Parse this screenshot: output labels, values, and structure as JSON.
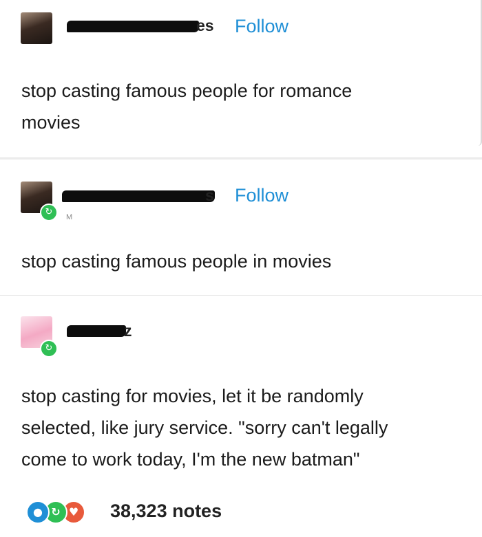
{
  "posts": [
    {
      "username_visible_suffix": "es",
      "follow_label": "Follow",
      "text_lines": [
        "stop casting famous people for romance",
        "movies"
      ]
    },
    {
      "username_visible_suffix": "s",
      "follow_label": "Follow",
      "meta": "M",
      "text_lines": [
        "stop casting famous people in movies"
      ]
    },
    {
      "username_visible_suffix": "z",
      "text_lines": [
        "stop casting for movies, let it be randomly",
        "selected, like jury service. \"sorry can't legally",
        "come to work today, I'm the new batman\""
      ]
    }
  ],
  "notes": {
    "count_label": "38,323 notes"
  },
  "icons": {
    "reblog": "reblog-icon",
    "reply": "reply-icon",
    "like": "heart-icon"
  },
  "colors": {
    "follow": "#1f8fd6",
    "reblog": "#2fbf55",
    "reply": "#1f8fd6",
    "like": "#e85a3c"
  }
}
